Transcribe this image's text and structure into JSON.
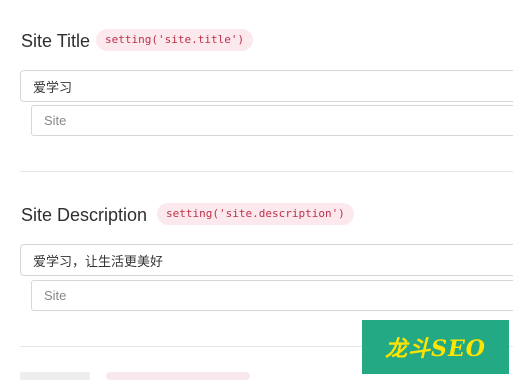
{
  "settings": [
    {
      "label": "Site Title",
      "code": "setting('site.title')",
      "value": "爱学习",
      "sub_value": "Site"
    },
    {
      "label": "Site Description",
      "code": "setting('site.description')",
      "value": "爱学习，让生活更美好",
      "sub_value": "Site"
    }
  ],
  "watermark": {
    "text": "龙斗SEO"
  },
  "colors": {
    "badge_bg": "#fbe9ee",
    "badge_text": "#c0304a",
    "watermark_bg": "#23a984",
    "watermark_text": "#ffe400"
  }
}
